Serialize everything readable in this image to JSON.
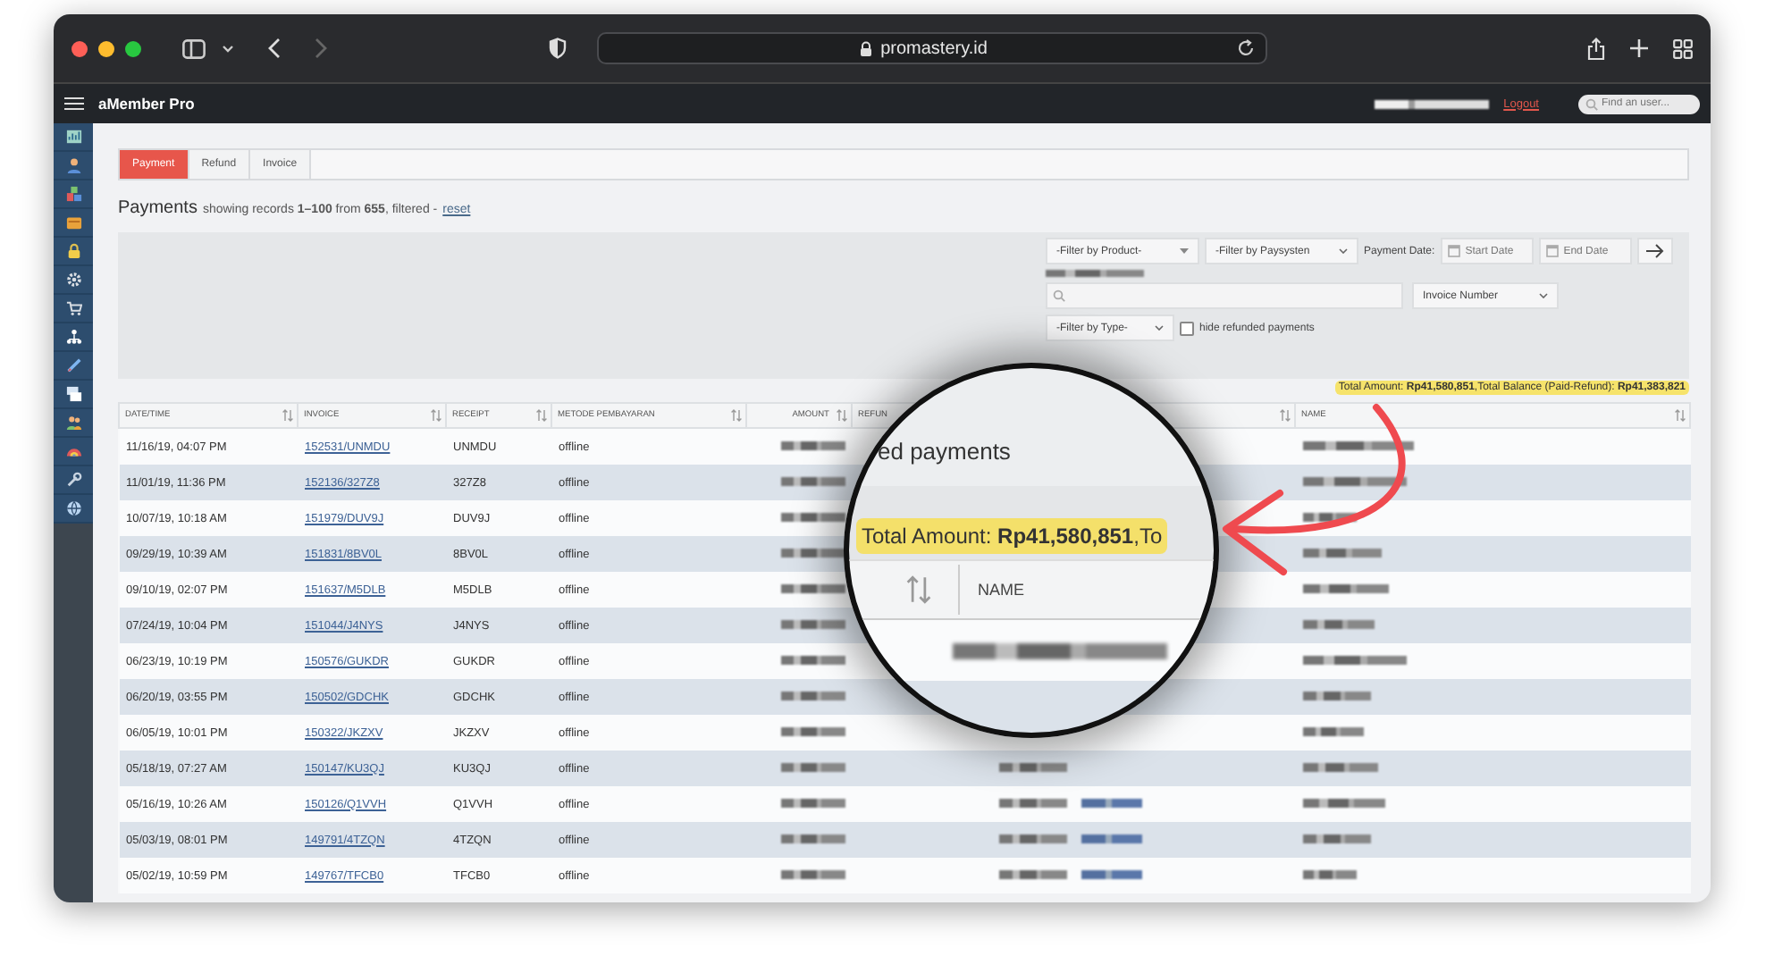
{
  "browser": {
    "url": "promastery.id",
    "forward_disabled": true
  },
  "app_header": {
    "title": "aMember Pro",
    "logout": "Logout",
    "search": {
      "placeholder": "Find an user..."
    }
  },
  "sidebar": {
    "items": [
      {
        "kind": "chart"
      },
      {
        "kind": "user"
      },
      {
        "kind": "blocks"
      },
      {
        "kind": "folder"
      },
      {
        "kind": "lock"
      },
      {
        "kind": "gear"
      },
      {
        "kind": "cart"
      },
      {
        "kind": "tree"
      },
      {
        "kind": "pen"
      },
      {
        "kind": "stack"
      },
      {
        "kind": "users"
      },
      {
        "kind": "fan"
      },
      {
        "kind": "wrench"
      },
      {
        "kind": "globe"
      }
    ]
  },
  "tabs": [
    {
      "label": "Payment",
      "selected": true
    },
    {
      "label": "Refund",
      "selected": false
    },
    {
      "label": "Invoice",
      "selected": false
    }
  ],
  "heading": {
    "title": "Payments",
    "summary": "showing records **1–100** from **655**, filtered -",
    "reset": "reset"
  },
  "filters": {
    "product": "-Filter by Product-",
    "paysystem": "-Filter by Paysysten",
    "date_label": "Payment Date:",
    "start_date": {
      "placeholder": "Start Date"
    },
    "end_date": {
      "placeholder": "End Date"
    },
    "search_by": "Invoice Number",
    "type": "-Filter by Type-",
    "hide_refunded": {
      "label": "hide refunded payments",
      "checked": false
    }
  },
  "totals": "Total Amount: **Rp41,580,851**,Total Balance (Paid-Refund): **Rp41,383,821**",
  "table": {
    "columns": [
      "DATE/TIME",
      "INVOICE",
      "RECEIPT",
      "METODE PEMBAYARAN",
      "AMOUNT",
      "REFUN",
      "",
      "NAME"
    ],
    "rows": [
      {
        "date": "11/16/19, 04:07 PM",
        "invoice": "152531/UNMDU",
        "receipt": "UNMDU",
        "method": "offline"
      },
      {
        "date": "11/01/19, 11:36 PM",
        "invoice": "152136/327Z8",
        "receipt": "327Z8",
        "method": "offline"
      },
      {
        "date": "10/07/19, 10:18 AM",
        "invoice": "151979/DUV9J",
        "receipt": "DUV9J",
        "method": "offline"
      },
      {
        "date": "09/29/19, 10:39 AM",
        "invoice": "151831/8BV0L",
        "receipt": "8BV0L",
        "method": "offline"
      },
      {
        "date": "09/10/19, 02:07 PM",
        "invoice": "151637/M5DLB",
        "receipt": "M5DLB",
        "method": "offline"
      },
      {
        "date": "07/24/19, 10:04 PM",
        "invoice": "151044/J4NYS",
        "receipt": "J4NYS",
        "method": "offline"
      },
      {
        "date": "06/23/19, 10:19 PM",
        "invoice": "150576/GUKDR",
        "receipt": "GUKDR",
        "method": "offline"
      },
      {
        "date": "06/20/19, 03:55 PM",
        "invoice": "150502/GDCHK",
        "receipt": "GDCHK",
        "method": "offline"
      },
      {
        "date": "06/05/19, 10:01 PM",
        "invoice": "150322/JKZXV",
        "receipt": "JKZXV",
        "method": "offline"
      },
      {
        "date": "05/18/19, 07:27 AM",
        "invoice": "150147/KU3QJ",
        "receipt": "KU3QJ",
        "method": "offline"
      },
      {
        "date": "05/16/19, 10:26 AM",
        "invoice": "150126/Q1VVH",
        "receipt": "Q1VVH",
        "method": "offline"
      },
      {
        "date": "05/03/19, 08:01 PM",
        "invoice": "149791/4TZQN",
        "receipt": "4TZQN",
        "method": "offline"
      },
      {
        "date": "05/02/19, 10:59 PM",
        "invoice": "149767/TFCB0",
        "receipt": "TFCB0",
        "method": "offline"
      }
    ]
  },
  "magnifier": {
    "heading_fragment": "ed payments",
    "total": "Total Amount: **Rp41,580,851**,To",
    "column": "NAME"
  }
}
